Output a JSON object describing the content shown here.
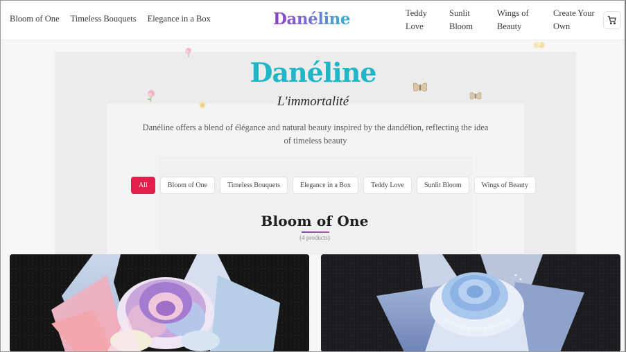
{
  "header": {
    "brand": "Danéline",
    "nav_left": [
      "Bloom of One",
      "Timeless Bouquets",
      "Elegance in a Box"
    ],
    "nav_right": [
      {
        "line1": "Teddy",
        "line2": "Love"
      },
      {
        "line1": "Sunlit",
        "line2": "Bloom"
      },
      {
        "line1": "Wings of",
        "line2": "Beauty"
      },
      {
        "line1": "Create Your",
        "line2": "Own"
      }
    ],
    "cart_icon": "cart-icon"
  },
  "hero": {
    "title": "Danéline",
    "subtitle": "L'immortalité",
    "description": "Danéline offers a blend of élégance and natural beauty inspired by the dandélion, reflecting the idea of timeless beauty"
  },
  "filters": {
    "active": "All",
    "items": [
      "All",
      "Bloom of One",
      "Timeless Bouquets",
      "Elegance in a Box",
      "Teddy Love",
      "Sunlit Bloom",
      "Wings of Beauty"
    ]
  },
  "section": {
    "title": "Bloom of One",
    "count": "(4 products)"
  },
  "products": [
    {
      "image": "pastel-rainbow-rose-bouquet"
    },
    {
      "image": "light-blue-rose-bouquet"
    }
  ],
  "colors": {
    "accent": "#e0204a",
    "hero_title": "#1fb6c8",
    "brand_start": "#8b3fc9",
    "brand_end": "#2fb5d6"
  }
}
